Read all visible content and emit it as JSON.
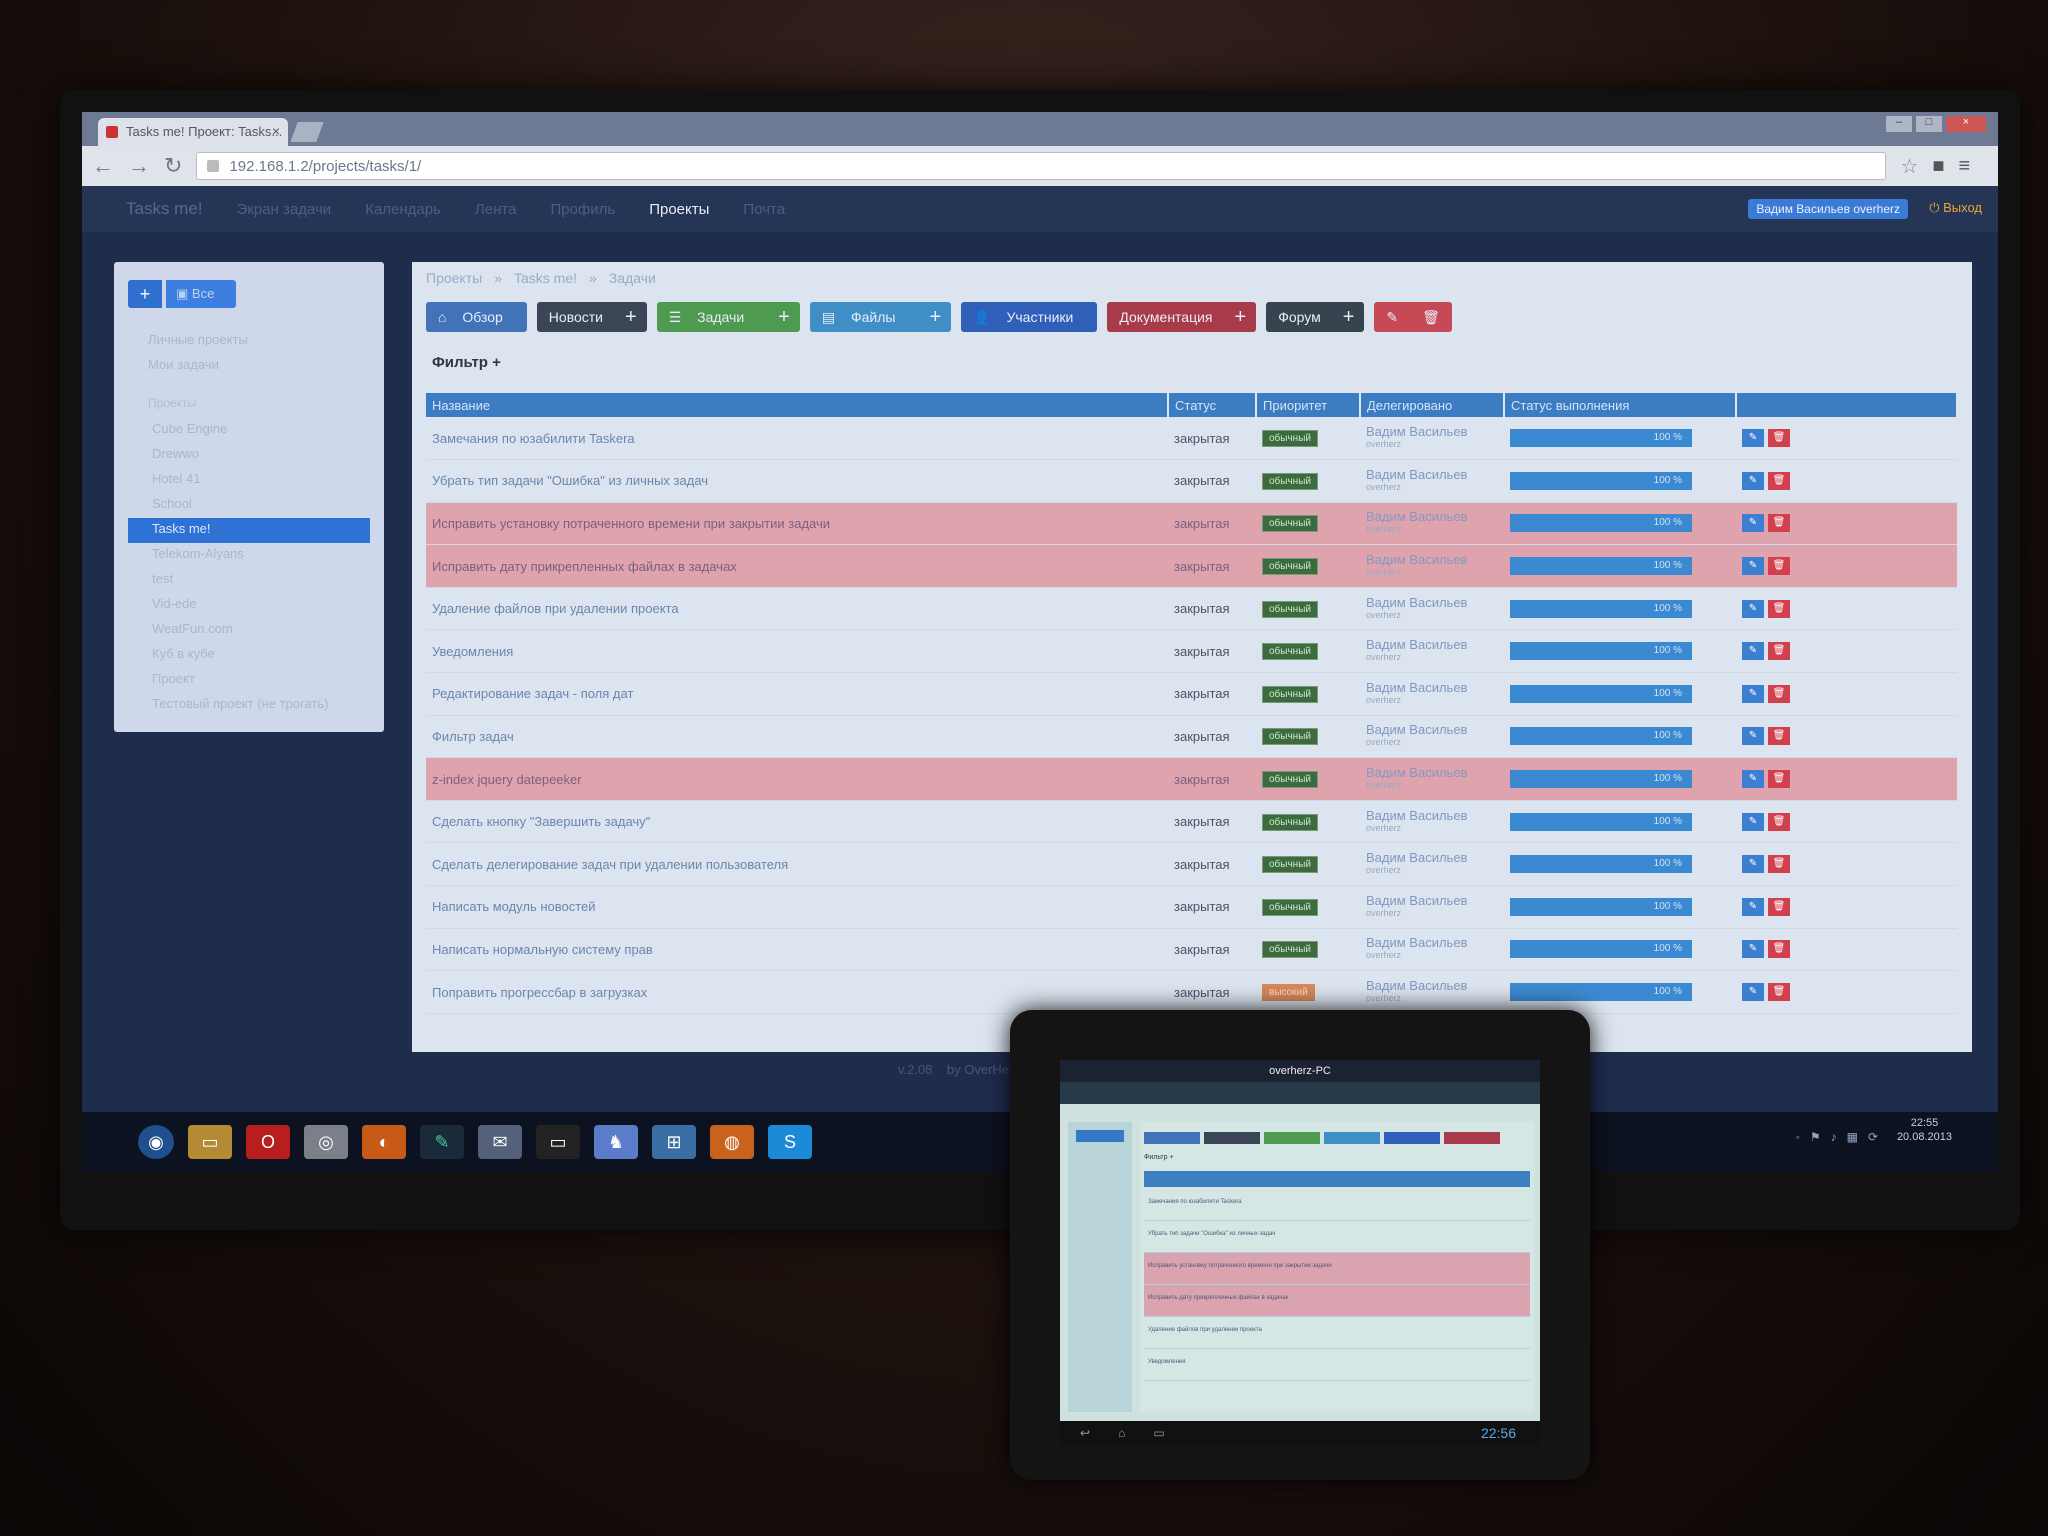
{
  "browser": {
    "tab_title": "Tasks me! Проект: Tasks...",
    "address": "192.168.1.2/projects/tasks/1/"
  },
  "appnav": {
    "items": [
      {
        "label": "Tasks me!"
      },
      {
        "label": "Экран задачи"
      },
      {
        "label": "Календарь"
      },
      {
        "label": "Лента"
      },
      {
        "label": "Профиль"
      },
      {
        "label": "Проекты"
      },
      {
        "label": "Почта"
      }
    ],
    "user": "Вадим Васильев overherz",
    "logout": "Выход"
  },
  "sidebar": {
    "all_label": "Все",
    "links": [
      "Личные проекты",
      "Мои задачи"
    ],
    "section": "Проекты",
    "projects": [
      "Cube Engine",
      "Drewwo",
      "Hotel 41",
      "School",
      "Tasks me!",
      "Telekom-Alyans",
      "test",
      "Vid-ede",
      "WeatFun.com",
      "Куб в кубе",
      "Проект",
      "Тестовый проект (не трогать)"
    ]
  },
  "breadcrumb": [
    "Проекты",
    "Tasks me!",
    "Задачи"
  ],
  "buttons": {
    "overview": "Обзор",
    "news": "Новости",
    "tasks": "Задачи",
    "files": "Файлы",
    "members": "Участники",
    "docs": "Документация",
    "forum": "Форум",
    "plus": "+"
  },
  "filter_label": "Фильтр +",
  "table": {
    "columns": [
      "Название",
      "Статус",
      "Приоритет",
      "Делегировано",
      "Статус выполнения"
    ],
    "rows": [
      {
        "title": "Замечания по юзабилити Taskera",
        "status": "закрытая",
        "priority": "обычный",
        "assignee": "Вадим Васильев",
        "login": "overherz",
        "progress": "100 %",
        "highlight": false
      },
      {
        "title": "Убрать тип задачи \"Ошибка\" из личных задач",
        "status": "закрытая",
        "priority": "обычный",
        "assignee": "Вадим Васильев",
        "login": "overherz",
        "progress": "100 %",
        "highlight": false
      },
      {
        "title": "Исправить установку потраченного времени при закрытии задачи",
        "status": "закрытая",
        "priority": "обычный",
        "assignee": "Вадим Васильев",
        "login": "overherz",
        "progress": "100 %",
        "highlight": true
      },
      {
        "title": "Исправить дату прикрепленных файлах в задачах",
        "status": "закрытая",
        "priority": "обычный",
        "assignee": "Вадим Васильев",
        "login": "overherz",
        "progress": "100 %",
        "highlight": true
      },
      {
        "title": "Удаление файлов при удалении проекта",
        "status": "закрытая",
        "priority": "обычный",
        "assignee": "Вадим Васильев",
        "login": "overherz",
        "progress": "100 %",
        "highlight": false
      },
      {
        "title": "Уведомления",
        "status": "закрытая",
        "priority": "обычный",
        "assignee": "Вадим Васильев",
        "login": "overherz",
        "progress": "100 %",
        "highlight": false
      },
      {
        "title": "Редактирование задач - поля дат",
        "status": "закрытая",
        "priority": "обычный",
        "assignee": "Вадим Васильев",
        "login": "overherz",
        "progress": "100 %",
        "highlight": false
      },
      {
        "title": "Фильтр задач",
        "status": "закрытая",
        "priority": "обычный",
        "assignee": "Вадим Васильев",
        "login": "overherz",
        "progress": "100 %",
        "highlight": false
      },
      {
        "title": "z-index jquery datepeeker",
        "status": "закрытая",
        "priority": "обычный",
        "assignee": "Вадим Васильев",
        "login": "overherz",
        "progress": "100 %",
        "highlight": true
      },
      {
        "title": "Сделать кнопку \"Завершить задачу\"",
        "status": "закрытая",
        "priority": "обычный",
        "assignee": "Вадим Васильев",
        "login": "overherz",
        "progress": "100 %",
        "highlight": false
      },
      {
        "title": "Сделать делегирование задач при удалении пользователя",
        "status": "закрытая",
        "priority": "обычный",
        "assignee": "Вадим Васильев",
        "login": "overherz",
        "progress": "100 %",
        "highlight": false
      },
      {
        "title": "Написать модуль новостей",
        "status": "закрытая",
        "priority": "обычный",
        "assignee": "Вадим Васильев",
        "login": "overherz",
        "progress": "100 %",
        "highlight": false
      },
      {
        "title": "Написать нормальную систему прав",
        "status": "закрытая",
        "priority": "обычный",
        "assignee": "Вадим Васильев",
        "login": "overherz",
        "progress": "100 %",
        "highlight": false
      },
      {
        "title": "Поправить прогрессбар в загрузках",
        "status": "закрытая",
        "priority": "высокий",
        "assignee": "Вадим Васильев",
        "login": "overherz",
        "progress": "100 %",
        "highlight": false
      }
    ]
  },
  "footer": {
    "version": "v.2.08",
    "author": "by OverHerz"
  },
  "clock": {
    "time": "22:55",
    "date": "20.08.2013"
  },
  "tablet": {
    "title": "overherz-PC",
    "time": "22:56"
  },
  "colors": {
    "accent": "#3c7cc3",
    "highlight_row": "#dfa3ad",
    "success": "#4e9a51",
    "danger": "#c64a56"
  }
}
